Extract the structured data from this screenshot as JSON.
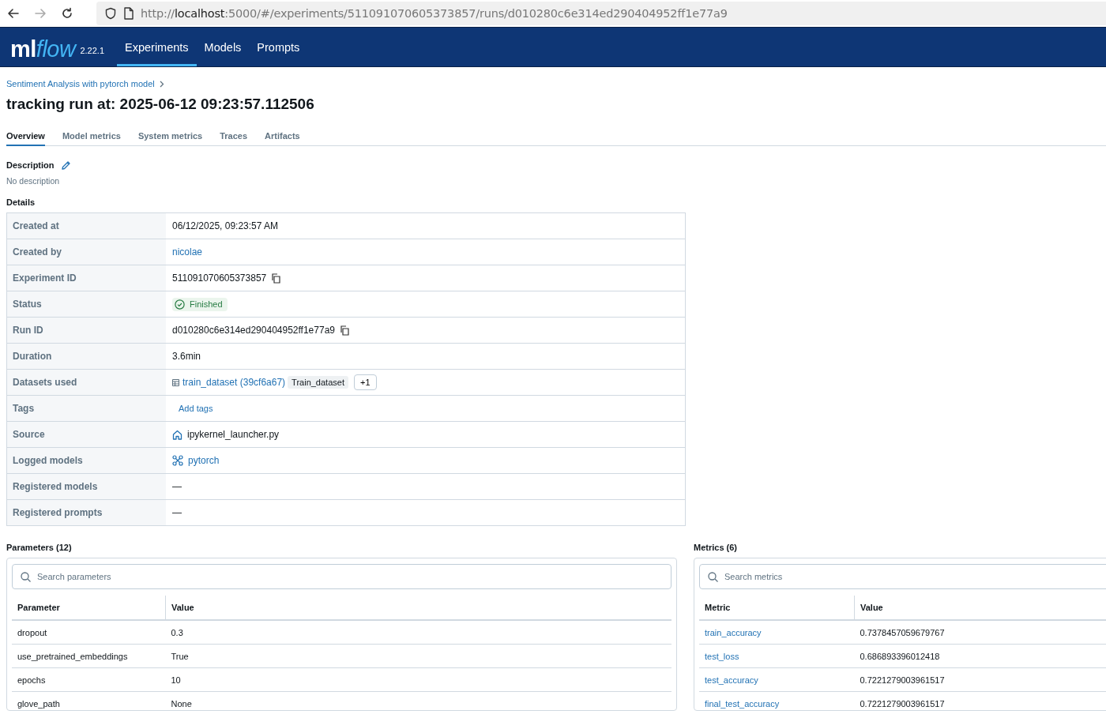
{
  "browser": {
    "url_host": "localhost",
    "url_prefix": "http://",
    "url_rest": ":5000/#/experiments/511091070605373857/runs/d010280c6e314ed290404952ff1e77a9"
  },
  "nav": {
    "logo_ml": "ml",
    "logo_flow": "flow",
    "version": "2.22.1",
    "items": [
      {
        "label": "Experiments",
        "selected": true
      },
      {
        "label": "Models",
        "selected": false
      },
      {
        "label": "Prompts",
        "selected": false
      }
    ]
  },
  "breadcrumb": "Sentiment Analysis with pytorch model",
  "title": "tracking run at: 2025-06-12 09:23:57.112506",
  "tabs": [
    {
      "label": "Overview",
      "selected": true
    },
    {
      "label": "Model metrics",
      "selected": false
    },
    {
      "label": "System metrics",
      "selected": false
    },
    {
      "label": "Traces",
      "selected": false
    },
    {
      "label": "Artifacts",
      "selected": false
    }
  ],
  "description": {
    "heading": "Description",
    "text": "No description"
  },
  "details": {
    "heading": "Details",
    "rows": [
      {
        "label": "Created at",
        "kind": "text",
        "value": "06/12/2025, 09:23:57 AM"
      },
      {
        "label": "Created by",
        "kind": "link",
        "value": "nicolae"
      },
      {
        "label": "Experiment ID",
        "kind": "copy",
        "value": "511091070605373857"
      },
      {
        "label": "Status",
        "kind": "status",
        "value": "Finished"
      },
      {
        "label": "Run ID",
        "kind": "copy",
        "value": "d010280c6e314ed290404952ff1e77a9"
      },
      {
        "label": "Duration",
        "kind": "text",
        "value": "3.6min"
      },
      {
        "label": "Datasets used",
        "kind": "datasets",
        "value": "train_dataset (39cf6a67)",
        "tag": "Train_dataset",
        "more": "+1"
      },
      {
        "label": "Tags",
        "kind": "add",
        "value": "Add tags"
      },
      {
        "label": "Source",
        "kind": "source",
        "value": "ipykernel_launcher.py"
      },
      {
        "label": "Logged models",
        "kind": "model",
        "value": "pytorch"
      },
      {
        "label": "Registered models",
        "kind": "text",
        "value": "—"
      },
      {
        "label": "Registered prompts",
        "kind": "text",
        "value": "—"
      }
    ]
  },
  "parameters": {
    "heading": "Parameters (12)",
    "placeholder": "Search parameters",
    "columns": [
      "Parameter",
      "Value"
    ],
    "rows": [
      {
        "name": "dropout",
        "value": "0.3"
      },
      {
        "name": "use_pretrained_embeddings",
        "value": "True"
      },
      {
        "name": "epochs",
        "value": "10"
      },
      {
        "name": "glove_path",
        "value": "None"
      }
    ]
  },
  "metrics": {
    "heading": "Metrics (6)",
    "placeholder": "Search metrics",
    "columns": [
      "Metric",
      "Value"
    ],
    "rows": [
      {
        "name": "train_accuracy",
        "value": "0.7378457059679767"
      },
      {
        "name": "test_loss",
        "value": "0.686893396012418"
      },
      {
        "name": "test_accuracy",
        "value": "0.7221279003961517"
      },
      {
        "name": "final_test_accuracy",
        "value": "0.7221279003961517"
      }
    ]
  }
}
